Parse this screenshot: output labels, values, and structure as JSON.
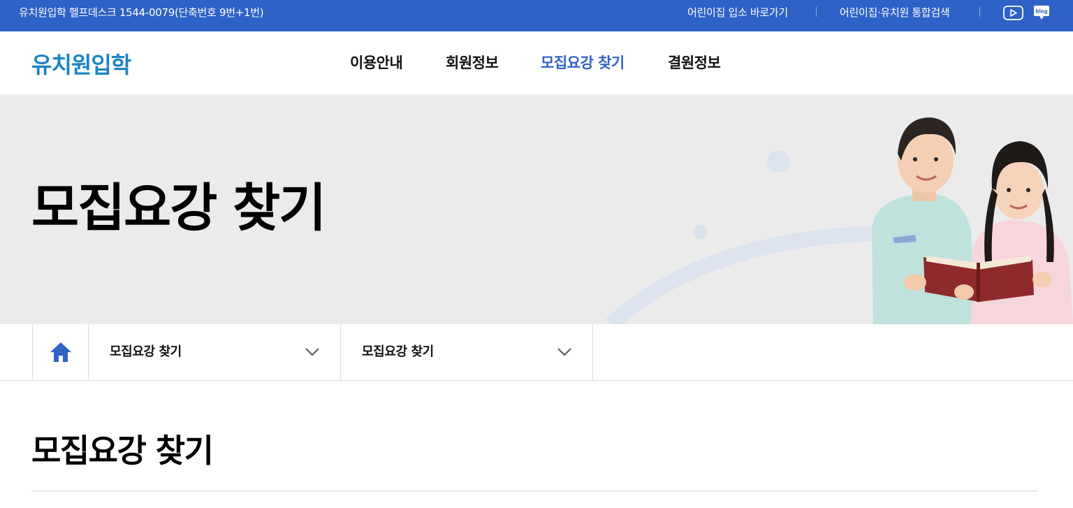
{
  "topbar": {
    "helpdesk": "유치원입학 헬프데스크 1544-0079(단축번호 9번+1번)",
    "link_daycare": "어린이집 입소 바로가기",
    "link_search": "어린이집·유치원 통합검색",
    "youtube_icon": "youtube-icon",
    "blog_icon": "blog-icon",
    "blog_text": "blog"
  },
  "header": {
    "logo": "유치원입학",
    "nav": [
      {
        "label": "이용안내"
      },
      {
        "label": "회원정보"
      },
      {
        "label": "모집요강 찾기",
        "active": true
      },
      {
        "label": "결원정보"
      }
    ]
  },
  "hero": {
    "title": "모집요강 찾기"
  },
  "breadcrumb": {
    "home_icon": "home-icon",
    "level1": "모집요강 찾기",
    "level2": "모집요강 찾기"
  },
  "content": {
    "title": "모집요강 찾기"
  },
  "colors": {
    "topbar": "#2f62c6",
    "logo": "#1c84c6",
    "active_nav": "#2f62c6",
    "hero_bg": "#ebebec"
  }
}
